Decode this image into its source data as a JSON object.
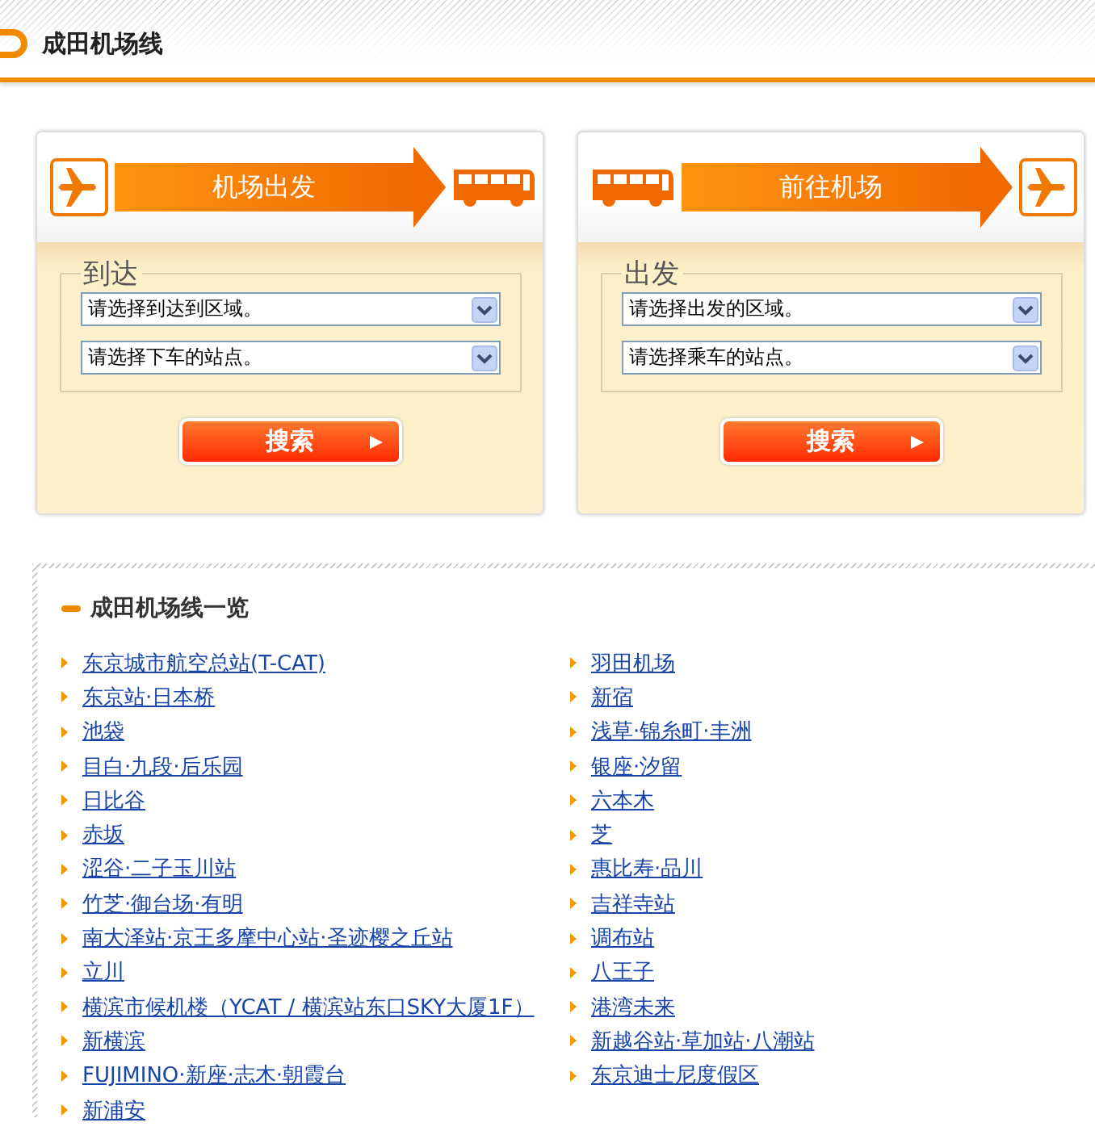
{
  "header": {
    "title": "成田机场线"
  },
  "cards": [
    {
      "kind": "outbound",
      "banner": "机场出发",
      "legend": "到达",
      "selects": [
        {
          "value": "请选择到达到区域。"
        },
        {
          "value": "请选择下车的站点。"
        }
      ],
      "button": "搜索"
    },
    {
      "kind": "inbound",
      "banner": "前往机场",
      "legend": "出发",
      "selects": [
        {
          "value": "请选择出发的区域。"
        },
        {
          "value": "请选择乘车的站点。"
        }
      ],
      "button": "搜索"
    }
  ],
  "list": {
    "title": "成田机场线一览",
    "columns": [
      [
        "东京城市航空总站(T-CAT)",
        "东京站·日本桥",
        "池袋",
        "目白·九段·后乐园",
        "日比谷",
        "赤坂",
        "涩谷·二子玉川站",
        "竹芝·御台场·有明",
        "南大泽站·京王多摩中心站·圣迹樱之丘站",
        "立川",
        "横滨市候机楼（YCAT / 横滨站东口SKY大厦1F）",
        "新横滨",
        "FUJIMINO·新座·志木·朝霞台",
        "新浦安"
      ],
      [
        "羽田机场",
        "新宿",
        "浅草·锦糸町·丰洲",
        "银座·汐留",
        "六本木",
        "芝",
        "惠比寿·品川",
        "吉祥寺站",
        "调布站",
        "八王子",
        "港湾未来",
        "新越谷站·草加站·八潮站",
        "东京迪士尼度假区"
      ]
    ]
  }
}
